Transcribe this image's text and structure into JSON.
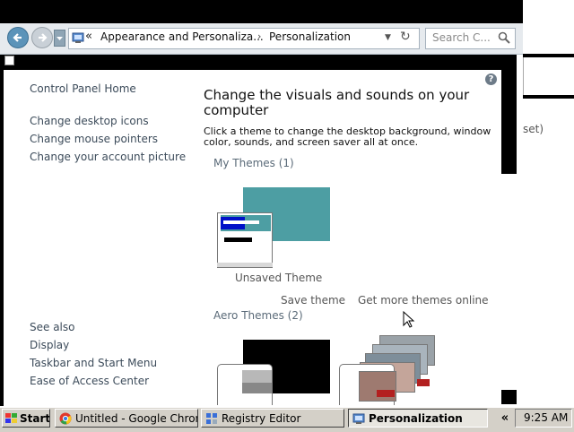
{
  "address_bar": {
    "path_part1": "Appearance and Personaliza...",
    "separator": "›",
    "path_part2": "Personalization",
    "prefix": "«"
  },
  "search": {
    "placeholder": "Search C..."
  },
  "sidebar": {
    "home": "Control Panel Home",
    "links": [
      "Change desktop icons",
      "Change mouse pointers",
      "Change your account picture"
    ],
    "see_also_heading": "See also",
    "see_also": [
      "Display",
      "Taskbar and Start Menu",
      "Ease of Access Center"
    ]
  },
  "main": {
    "title_line1": "Change the visuals and sounds on your",
    "title_line2": "computer",
    "desc_line1": "Click a theme to change the desktop background, window",
    "desc_line2": "color, sounds, and screen saver all at once.",
    "my_themes": "My Themes (1)",
    "unsaved_theme": "Unsaved Theme",
    "save_theme": "Save theme",
    "get_more": "Get more themes online",
    "aero_themes": "Aero Themes (2)"
  },
  "background_window": {
    "fragment": "set)"
  },
  "taskbar": {
    "start": "Start",
    "items": [
      {
        "label": "Untitled - Google Chrome",
        "icon": "chrome-icon"
      },
      {
        "label": "Registry Editor",
        "icon": "regedit-icon"
      },
      {
        "label": "Personalization",
        "icon": "personalization-icon",
        "active": true
      }
    ],
    "tray_chevron": "«",
    "clock": "9:25 AM"
  },
  "colors": {
    "theme_teal": "#4d9ea3",
    "link_text": "#3c4b5a",
    "taskbar": "#d4d0c8"
  }
}
